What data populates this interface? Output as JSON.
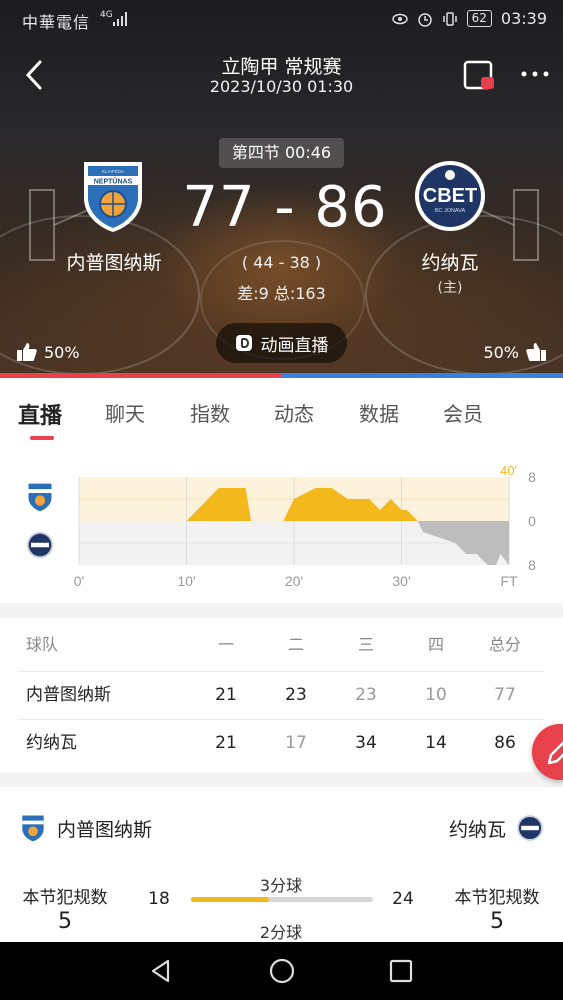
{
  "status_bar": {
    "carrier": "中華電信",
    "network": "4G",
    "battery": "62",
    "time": "03:39",
    "icons": [
      "eye-icon",
      "alarm-icon",
      "vibrate-icon",
      "battery-icon",
      "signal-icon"
    ]
  },
  "header": {
    "league": "立陶甲 常规赛",
    "datetime": "2023/10/30 01:30"
  },
  "match": {
    "period": "第四节 00:46",
    "score": "77 - 86",
    "halftime": "( 44 - 38 )",
    "diff_total": "差:9 总:163",
    "home": {
      "name": "内普图纳斯",
      "logo_text": "NEPTŪNAS",
      "logo_small": "KLAIPĖDA",
      "likes": "50%"
    },
    "away": {
      "name": "约纳瓦",
      "host": "(主)",
      "logo_text": "CBET",
      "logo_small": "BC JONAVA",
      "likes": "50%"
    },
    "live_animation_label": "动画直播",
    "colors": {
      "home": "#e8414b",
      "away": "#3b7fe0",
      "trend_home": "#f2b81c",
      "trend_away": "#bdbdbd"
    }
  },
  "tabs": [
    "直播",
    "聊天",
    "指数",
    "动态",
    "数据",
    "会员"
  ],
  "chart_data": {
    "type": "area",
    "x_ticks": [
      "0'",
      "10'",
      "20'",
      "30'",
      "FT"
    ],
    "y_ticks_right": [
      "8",
      "0",
      "8"
    ],
    "corner_label": "40'",
    "ylim": [
      -8,
      8
    ],
    "xlim": [
      0,
      40
    ],
    "series": [
      {
        "points": [
          [
            0,
            0
          ],
          [
            10,
            0
          ],
          [
            11,
            2
          ],
          [
            13,
            6
          ],
          [
            14,
            6
          ],
          [
            15.5,
            6
          ],
          [
            16,
            0
          ],
          [
            19,
            0
          ],
          [
            20,
            4
          ],
          [
            22,
            6
          ],
          [
            23.5,
            6
          ],
          [
            25,
            4
          ],
          [
            27,
            4
          ],
          [
            28,
            2
          ],
          [
            29,
            4
          ],
          [
            30,
            2
          ],
          [
            30.5,
            2
          ],
          [
            31.5,
            0
          ],
          [
            32,
            -2
          ],
          [
            35,
            -4
          ],
          [
            36,
            -6
          ],
          [
            37,
            -6
          ],
          [
            38,
            -8
          ],
          [
            38.8,
            -8
          ],
          [
            39.2,
            -6
          ],
          [
            40,
            -8
          ]
        ]
      }
    ],
    "grid": true
  },
  "score_table": {
    "headers": [
      "球队",
      "一",
      "二",
      "三",
      "四",
      "总分"
    ],
    "rows": [
      {
        "team": "内普图纳斯",
        "q1": "21",
        "q2": "23",
        "q3": "23",
        "q4": "10",
        "total": "77"
      },
      {
        "team": "约纳瓦",
        "q1": "21",
        "q2": "17",
        "q3": "34",
        "q4": "14",
        "total": "86"
      }
    ]
  },
  "stats": {
    "home_name": "内普图纳斯",
    "away_name": "约纳瓦",
    "foul_label": "本节犯规数",
    "home_fouls": "5",
    "away_fouls": "5",
    "items": [
      {
        "label": "3分球",
        "home": "18",
        "away": "24",
        "home_share": 0.43
      },
      {
        "label": "2分球",
        "home": "",
        "away": "",
        "home_share": 0.5
      }
    ]
  },
  "navbar": {
    "icons": [
      "back-triangle-icon",
      "home-circle-icon",
      "recents-square-icon"
    ]
  }
}
